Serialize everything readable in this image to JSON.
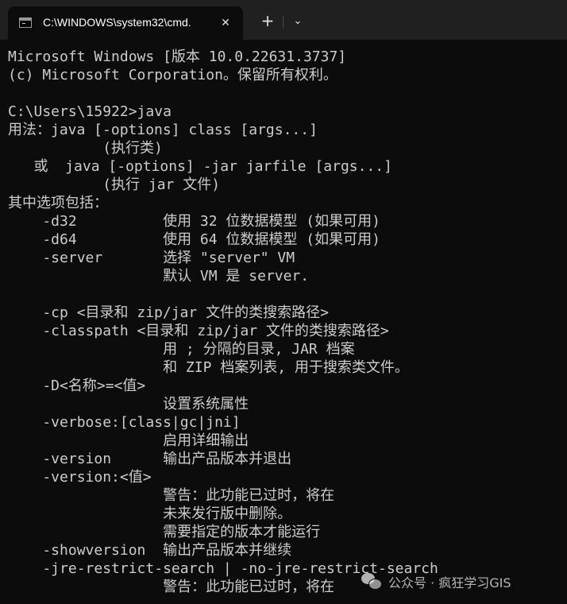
{
  "window": {
    "tab_title": "C:\\WINDOWS\\system32\\cmd.",
    "tab_icon": "cmd-icon",
    "close_glyph": "✕",
    "new_tab_glyph": "+",
    "dropdown_glyph": "⌄"
  },
  "terminal": {
    "lines": [
      "Microsoft Windows [版本 10.0.22631.3737]",
      "(c) Microsoft Corporation。保留所有权利。",
      "",
      "C:\\Users\\15922>java",
      "用法：java [-options] class [args...]",
      "           (执行类)",
      "   或  java [-options] -jar jarfile [args...]",
      "           (执行 jar 文件)",
      "其中选项包括：",
      "    -d32          使用 32 位数据模型 (如果可用)",
      "    -d64          使用 64 位数据模型 (如果可用)",
      "    -server       选择 \"server\" VM",
      "                  默认 VM 是 server.",
      "",
      "    -cp <目录和 zip/jar 文件的类搜索路径>",
      "    -classpath <目录和 zip/jar 文件的类搜索路径>",
      "                  用 ; 分隔的目录, JAR 档案",
      "                  和 ZIP 档案列表, 用于搜索类文件。",
      "    -D<名称>=<值>",
      "                  设置系统属性",
      "    -verbose:[class|gc|jni]",
      "                  启用详细输出",
      "    -version      输出产品版本并退出",
      "    -version:<值>",
      "                  警告：此功能已过时，将在",
      "                  未来发行版中删除。",
      "                  需要指定的版本才能运行",
      "    -showversion  输出产品版本并继续",
      "    -jre-restrict-search | -no-jre-restrict-search",
      "                  警告：此功能已过时，将在"
    ]
  },
  "watermark": {
    "icon": "wechat-icon",
    "text": "公众号 · 疯狂学习GIS"
  },
  "colors": {
    "background": "#0c0c0c",
    "titlebar": "#202020",
    "text": "#cccccc"
  }
}
